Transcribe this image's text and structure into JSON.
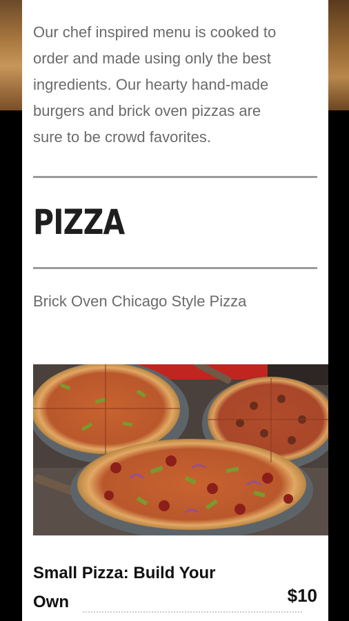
{
  "intro": {
    "lines": [
      "Our chef inspired menu is cooked to",
      "order and made using only the best",
      "ingredients. Our hearty hand-made",
      "burgers and brick oven pizzas are",
      "sure to be crowd favorites."
    ]
  },
  "section": {
    "title": "PIZZA",
    "subtitle": "Brick Oven Chicago Style Pizza"
  },
  "image": {
    "alt_icon": "pizza-photo"
  },
  "item": {
    "name_line1": "Small Pizza: Build Your",
    "name_line2": "Own",
    "price": "$10"
  },
  "colors": {
    "panel": "#ffffff",
    "text_muted": "#6a6a6a",
    "rule": "#9a9a9a",
    "heading": "#1e1e1e"
  }
}
